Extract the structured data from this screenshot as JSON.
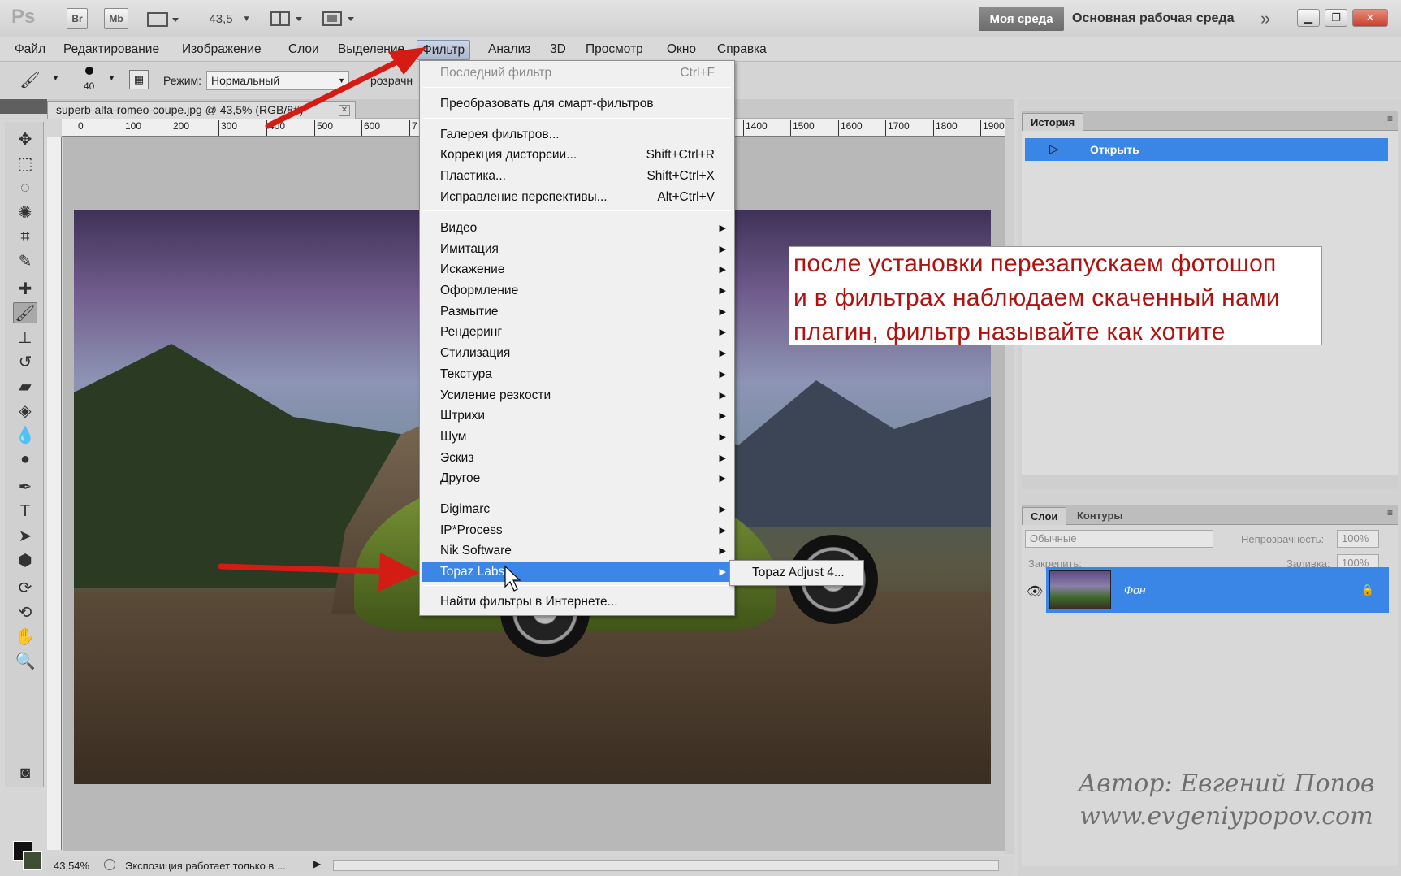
{
  "titlebar": {
    "logo": "Ps",
    "bridge_label": "Br",
    "minibridge_label": "Mb",
    "zoom": "43,5",
    "workspace_active": "Моя среда",
    "workspace_main": "Основная рабочая среда"
  },
  "menubar": {
    "items": [
      "Файл",
      "Редактирование",
      "Изображение",
      "Слои",
      "Выделение",
      "Фильтр",
      "Анализ",
      "3D",
      "Просмотр",
      "Окно",
      "Справка"
    ]
  },
  "options": {
    "brush_size": "40",
    "mode_label": "Режим:",
    "mode_value": "Нормальный",
    "opacity_label_partial": "розрачн"
  },
  "document": {
    "tab_title": "superb-alfa-romeo-coupe.jpg @ 43,5% (RGB/8#)",
    "ruler_ticks": [
      "0",
      "100",
      "200",
      "300",
      "400",
      "500",
      "600",
      "7",
      "1400",
      "1500",
      "1600",
      "1700",
      "1800",
      "1900"
    ]
  },
  "filter_menu": {
    "last_filter": {
      "label": "Последний фильтр",
      "shortcut": "Ctrl+F"
    },
    "smart": "Преобразовать для смарт-фильтров",
    "gallery": "Галерея фильтров...",
    "lens": {
      "label": "Коррекция дисторсии...",
      "shortcut": "Shift+Ctrl+R"
    },
    "liquify": {
      "label": "Пластика...",
      "shortcut": "Shift+Ctrl+X"
    },
    "vanish": {
      "label": "Исправление перспективы...",
      "shortcut": "Alt+Ctrl+V"
    },
    "groups": [
      "Видео",
      "Имитация",
      "Искажение",
      "Оформление",
      "Размытие",
      "Рендеринг",
      "Стилизация",
      "Текстура",
      "Усиление резкости",
      "Штрихи",
      "Шум",
      "Эскиз",
      "Другое"
    ],
    "plugins": [
      "Digimarc",
      "IP*Process",
      "Nik Software",
      "Topaz Labs"
    ],
    "browse": "Найти фильтры в Интернете..."
  },
  "submenu": {
    "item": "Topaz Adjust 4..."
  },
  "history": {
    "tab": "История",
    "item": "Открыть"
  },
  "layers": {
    "tab_layers": "Слои",
    "tab_paths": "Контуры",
    "blend_mode": "Обычные",
    "opacity_label": "Непрозрачность:",
    "opacity_value": "100%",
    "lock_label": "Закрепить:",
    "fill_label": "Заливка:",
    "fill_value": "100%",
    "layer_name": "Фон"
  },
  "annotation": {
    "line1": "после установки перезапускаем фотошоп",
    "line2": "и в фильтрах наблюдаем скаченный нами",
    "line3": "плагин, фильтр называйте как хотите"
  },
  "watermark": {
    "author": "Автор: Евгений Попов",
    "site": "www.evgeniypopov.com"
  },
  "status": {
    "zoom": "43,54%",
    "info": "Экспозиция работает только в ..."
  },
  "colors": {
    "highlight": "#3b86e7",
    "annotation_text": "#b0120f",
    "arrow": "#d41c14"
  }
}
